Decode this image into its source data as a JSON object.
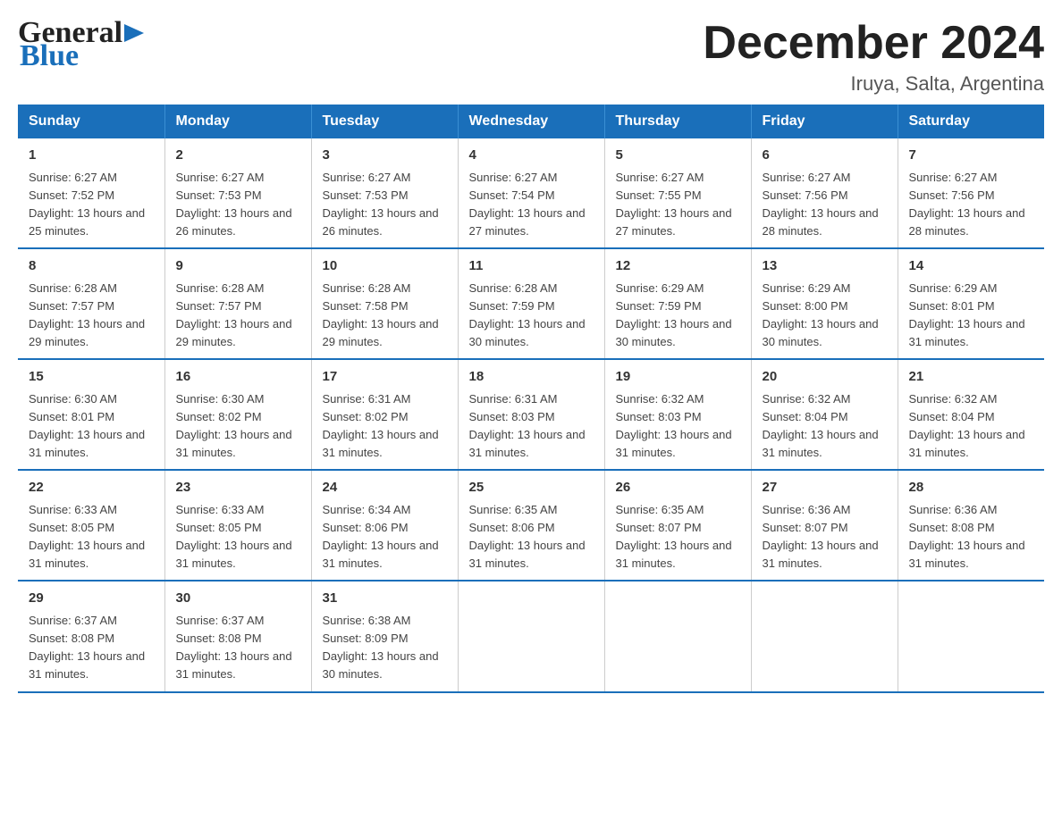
{
  "header": {
    "logo_general": "General",
    "logo_blue": "Blue",
    "month_title": "December 2024",
    "location": "Iruya, Salta, Argentina"
  },
  "days_of_week": [
    "Sunday",
    "Monday",
    "Tuesday",
    "Wednesday",
    "Thursday",
    "Friday",
    "Saturday"
  ],
  "weeks": [
    [
      {
        "day": "1",
        "sunrise": "6:27 AM",
        "sunset": "7:52 PM",
        "daylight": "13 hours and 25 minutes."
      },
      {
        "day": "2",
        "sunrise": "6:27 AM",
        "sunset": "7:53 PM",
        "daylight": "13 hours and 26 minutes."
      },
      {
        "day": "3",
        "sunrise": "6:27 AM",
        "sunset": "7:53 PM",
        "daylight": "13 hours and 26 minutes."
      },
      {
        "day": "4",
        "sunrise": "6:27 AM",
        "sunset": "7:54 PM",
        "daylight": "13 hours and 27 minutes."
      },
      {
        "day": "5",
        "sunrise": "6:27 AM",
        "sunset": "7:55 PM",
        "daylight": "13 hours and 27 minutes."
      },
      {
        "day": "6",
        "sunrise": "6:27 AM",
        "sunset": "7:56 PM",
        "daylight": "13 hours and 28 minutes."
      },
      {
        "day": "7",
        "sunrise": "6:27 AM",
        "sunset": "7:56 PM",
        "daylight": "13 hours and 28 minutes."
      }
    ],
    [
      {
        "day": "8",
        "sunrise": "6:28 AM",
        "sunset": "7:57 PM",
        "daylight": "13 hours and 29 minutes."
      },
      {
        "day": "9",
        "sunrise": "6:28 AM",
        "sunset": "7:57 PM",
        "daylight": "13 hours and 29 minutes."
      },
      {
        "day": "10",
        "sunrise": "6:28 AM",
        "sunset": "7:58 PM",
        "daylight": "13 hours and 29 minutes."
      },
      {
        "day": "11",
        "sunrise": "6:28 AM",
        "sunset": "7:59 PM",
        "daylight": "13 hours and 30 minutes."
      },
      {
        "day": "12",
        "sunrise": "6:29 AM",
        "sunset": "7:59 PM",
        "daylight": "13 hours and 30 minutes."
      },
      {
        "day": "13",
        "sunrise": "6:29 AM",
        "sunset": "8:00 PM",
        "daylight": "13 hours and 30 minutes."
      },
      {
        "day": "14",
        "sunrise": "6:29 AM",
        "sunset": "8:01 PM",
        "daylight": "13 hours and 31 minutes."
      }
    ],
    [
      {
        "day": "15",
        "sunrise": "6:30 AM",
        "sunset": "8:01 PM",
        "daylight": "13 hours and 31 minutes."
      },
      {
        "day": "16",
        "sunrise": "6:30 AM",
        "sunset": "8:02 PM",
        "daylight": "13 hours and 31 minutes."
      },
      {
        "day": "17",
        "sunrise": "6:31 AM",
        "sunset": "8:02 PM",
        "daylight": "13 hours and 31 minutes."
      },
      {
        "day": "18",
        "sunrise": "6:31 AM",
        "sunset": "8:03 PM",
        "daylight": "13 hours and 31 minutes."
      },
      {
        "day": "19",
        "sunrise": "6:32 AM",
        "sunset": "8:03 PM",
        "daylight": "13 hours and 31 minutes."
      },
      {
        "day": "20",
        "sunrise": "6:32 AM",
        "sunset": "8:04 PM",
        "daylight": "13 hours and 31 minutes."
      },
      {
        "day": "21",
        "sunrise": "6:32 AM",
        "sunset": "8:04 PM",
        "daylight": "13 hours and 31 minutes."
      }
    ],
    [
      {
        "day": "22",
        "sunrise": "6:33 AM",
        "sunset": "8:05 PM",
        "daylight": "13 hours and 31 minutes."
      },
      {
        "day": "23",
        "sunrise": "6:33 AM",
        "sunset": "8:05 PM",
        "daylight": "13 hours and 31 minutes."
      },
      {
        "day": "24",
        "sunrise": "6:34 AM",
        "sunset": "8:06 PM",
        "daylight": "13 hours and 31 minutes."
      },
      {
        "day": "25",
        "sunrise": "6:35 AM",
        "sunset": "8:06 PM",
        "daylight": "13 hours and 31 minutes."
      },
      {
        "day": "26",
        "sunrise": "6:35 AM",
        "sunset": "8:07 PM",
        "daylight": "13 hours and 31 minutes."
      },
      {
        "day": "27",
        "sunrise": "6:36 AM",
        "sunset": "8:07 PM",
        "daylight": "13 hours and 31 minutes."
      },
      {
        "day": "28",
        "sunrise": "6:36 AM",
        "sunset": "8:08 PM",
        "daylight": "13 hours and 31 minutes."
      }
    ],
    [
      {
        "day": "29",
        "sunrise": "6:37 AM",
        "sunset": "8:08 PM",
        "daylight": "13 hours and 31 minutes."
      },
      {
        "day": "30",
        "sunrise": "6:37 AM",
        "sunset": "8:08 PM",
        "daylight": "13 hours and 31 minutes."
      },
      {
        "day": "31",
        "sunrise": "6:38 AM",
        "sunset": "8:09 PM",
        "daylight": "13 hours and 30 minutes."
      },
      null,
      null,
      null,
      null
    ]
  ],
  "labels": {
    "sunrise_prefix": "Sunrise: ",
    "sunset_prefix": "Sunset: ",
    "daylight_prefix": "Daylight: "
  }
}
